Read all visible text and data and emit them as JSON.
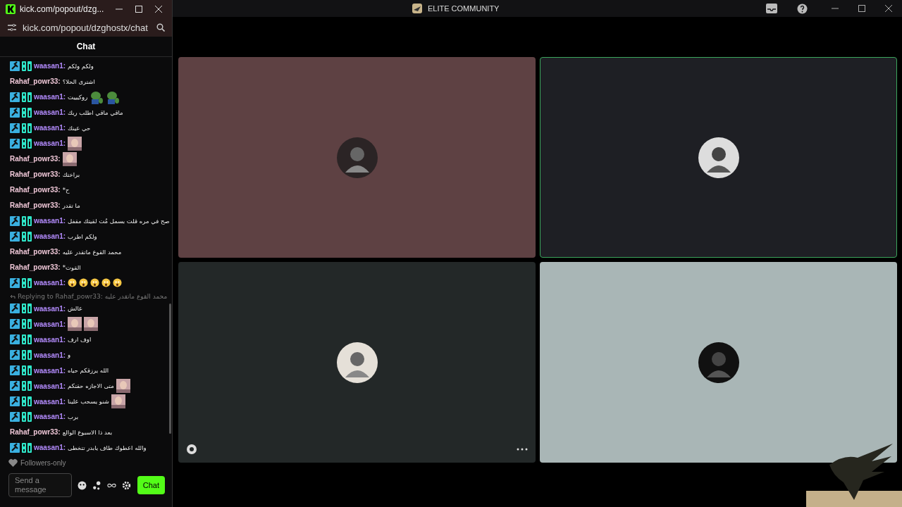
{
  "popup": {
    "title": "kick.com/popout/dzg...",
    "address": "kick.com/popout/dzghostx/chat",
    "header": "Chat"
  },
  "messages": [
    {
      "user": "waasan1:",
      "moderator": true,
      "text": "ولكم ولكم"
    },
    {
      "user": "Rahaf_powr33:",
      "moderator": false,
      "text": "اشترى الحلا؟"
    },
    {
      "user": "waasan1:",
      "moderator": true,
      "text": "روكيييت",
      "attachments": [
        {
          "kind": "frog"
        },
        {
          "kind": "frog"
        }
      ]
    },
    {
      "user": "waasan1:",
      "moderator": true,
      "text": "ماقي ماقي اطلب ربك"
    },
    {
      "user": "waasan1:",
      "moderator": true,
      "text": "حي عينك"
    },
    {
      "user": "waasan1:",
      "moderator": true
    },
    {
      "user": "Rahaf_powr33:",
      "moderator": false
    },
    {
      "user": "Rahaf_powr33:",
      "moderator": false,
      "text": "براختك"
    },
    {
      "user": "Rahaf_powr33:",
      "moderator": false,
      "text": "ح*"
    },
    {
      "user": "Rahaf_powr33:",
      "moderator": false,
      "text": "ما تقدر"
    },
    {
      "user": "waasan1:",
      "moderator": true,
      "text": "صح في مره قلت بسمل مُت لقيتك مقفل"
    },
    {
      "user": "waasan1:",
      "moderator": true,
      "text": "ولكم اطرب"
    },
    {
      "user": "Rahaf_powr33:",
      "moderator": false,
      "text": "محمد القوع ماتقدر عليه"
    },
    {
      "user": "Rahaf_powr33:",
      "moderator": false,
      "text": "القوت*"
    },
    {
      "user": "waasan1:",
      "moderator": true,
      "attachments": [
        {
          "kind": "emoji"
        },
        {
          "kind": "emoji"
        },
        {
          "kind": "emoji"
        },
        {
          "kind": "emoji"
        },
        {
          "kind": "emoji"
        }
      ]
    },
    {
      "reply": "Replying to Rahaf_powr33: محمد القوع ماتقدر عليه",
      "user": "waasan1:",
      "moderator": true,
      "text": "عالش"
    },
    {
      "user": "waasan1:",
      "moderator": true
    },
    {
      "user": "waasan1:",
      "moderator": true,
      "text": "اوف ارف"
    },
    {
      "user": "waasan1:",
      "moderator": true,
      "text": "و"
    },
    {
      "user": "waasan1:",
      "moderator": true,
      "text": "الله يرزقكم حياه"
    },
    {
      "user": "waasan1:",
      "moderator": true,
      "text": "متى الاجازه حقتكم"
    },
    {
      "user": "waasan1:",
      "moderator": true,
      "text": "شنو يسحب علينا"
    },
    {
      "user": "waasan1:",
      "moderator": true,
      "text": "برب"
    },
    {
      "user": "Rahaf_powr33:",
      "moderator": false,
      "text": "بعد ذا الاسبوع الوالع"
    },
    {
      "user": "waasan1:",
      "moderator": true,
      "text": "والله اعطوك طاف يابدر تتخطى"
    }
  ],
  "chat_mode": "Followers-only",
  "input": {
    "placeholder": "Send a message"
  },
  "send_button": "Chat",
  "app": {
    "title": "ELITE COMMUNITY"
  },
  "tiles": [
    {
      "color": "#5e4143",
      "speaking": false,
      "controls": false
    },
    {
      "color": "#1e1f24",
      "speaking": true,
      "controls": false
    },
    {
      "color": "#232828",
      "speaking": false,
      "controls": true
    },
    {
      "color": "#a9b6b6",
      "speaking": false,
      "controls": false
    }
  ]
}
